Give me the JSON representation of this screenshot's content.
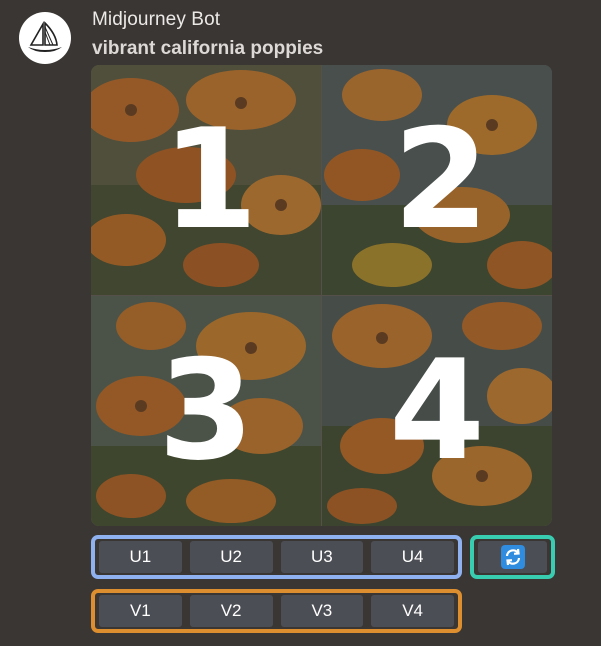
{
  "message": {
    "author": "Midjourney Bot",
    "prompt": "vibrant california poppies",
    "avatar_icon": "sailboat-icon"
  },
  "image_grid": {
    "quadrants": [
      {
        "number": "1"
      },
      {
        "number": "2"
      },
      {
        "number": "3"
      },
      {
        "number": "4"
      }
    ]
  },
  "upscale_buttons": [
    "U1",
    "U2",
    "U3",
    "U4"
  ],
  "variation_buttons": [
    "V1",
    "V2",
    "V3",
    "V4"
  ],
  "reroll": {
    "icon": "refresh-icon",
    "color": "#2f8cdf"
  },
  "colors": {
    "background": "#3a3633",
    "upscale_outline": "#8fb1f0",
    "variation_outline": "#dd8e2f",
    "reroll_outline": "#38cdb0",
    "button_bg": "#4c4e55"
  }
}
